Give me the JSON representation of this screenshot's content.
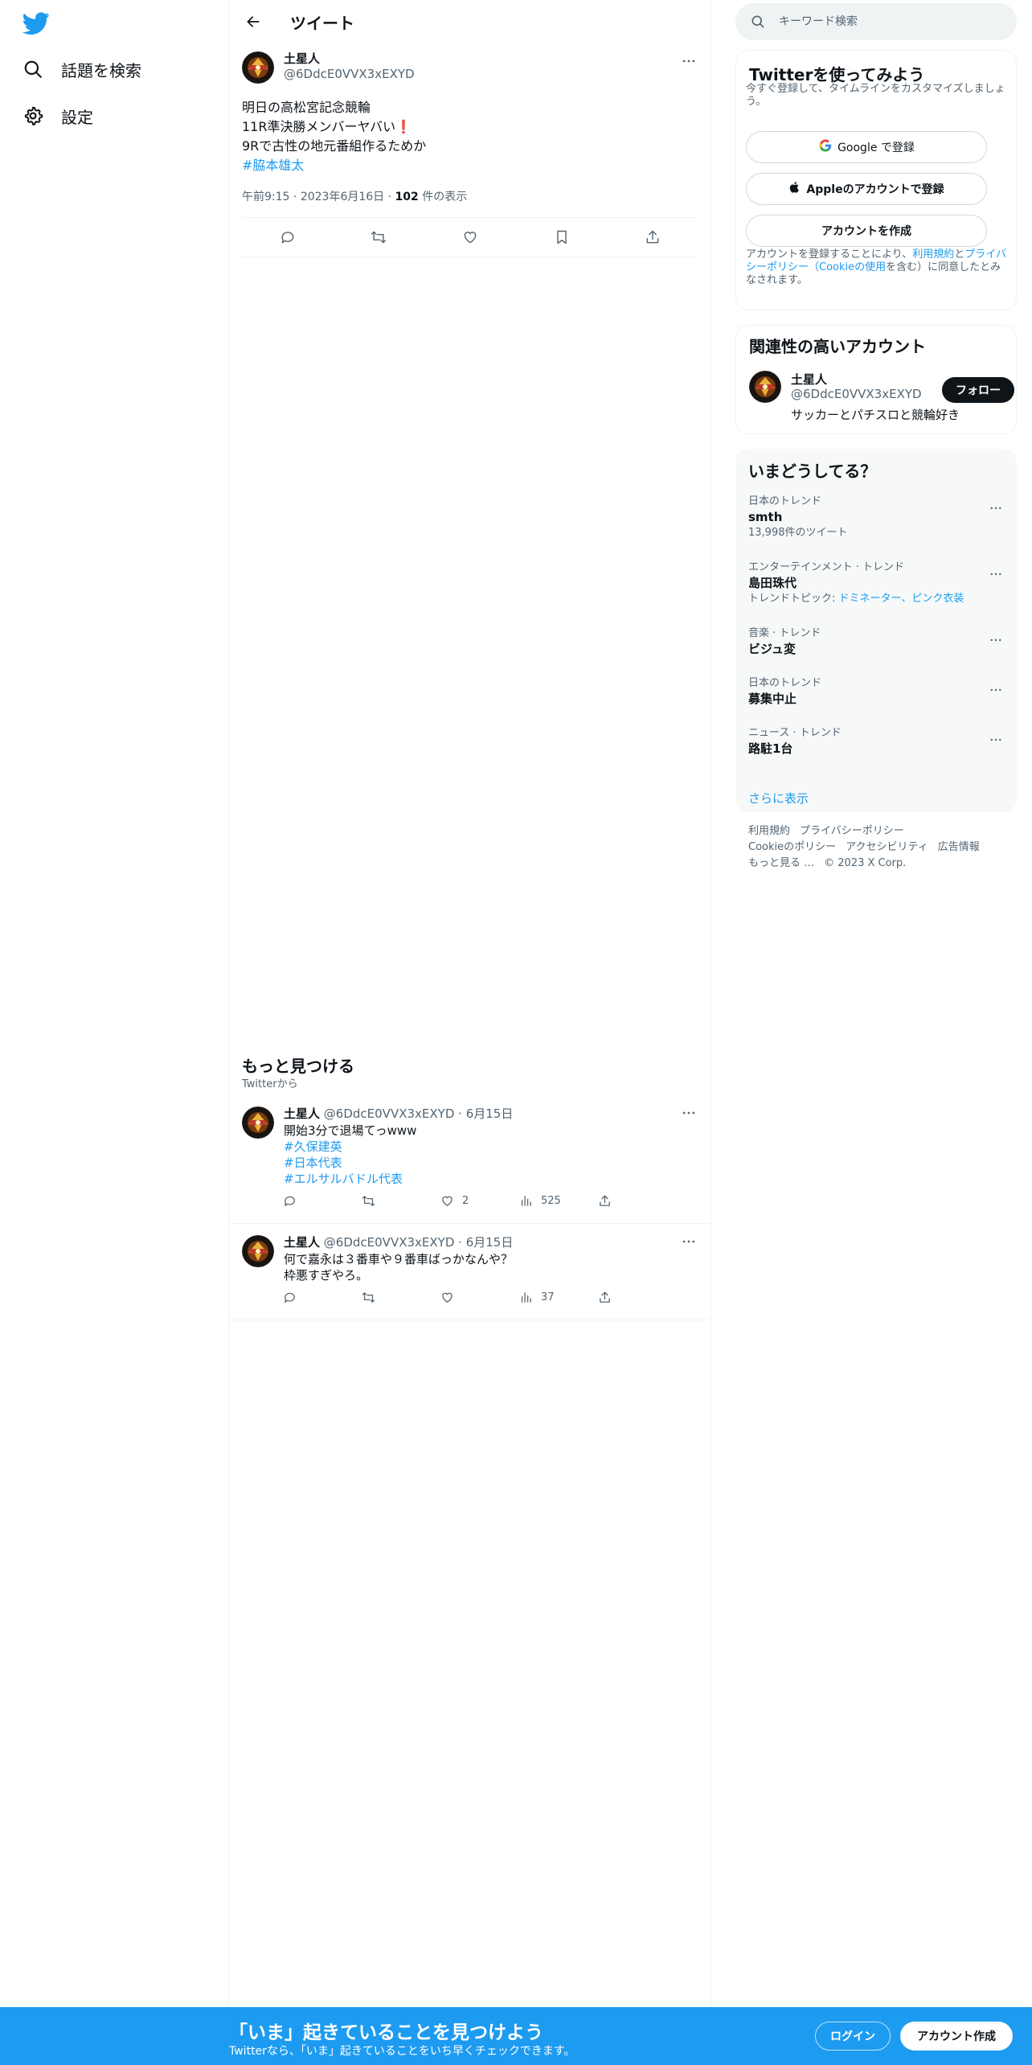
{
  "colors": {
    "brand": "#1d9bf0",
    "text": "#0f1419",
    "muted": "#536471"
  },
  "nav": {
    "logo_icon": "twitter-bird-icon",
    "items": [
      {
        "label": "話題を検索",
        "icon": "search-icon"
      },
      {
        "label": "設定",
        "icon": "gear-icon"
      }
    ]
  },
  "main": {
    "header_title": "ツイート",
    "tweet": {
      "name": "土星人",
      "handle": "@6DdcE0VVX3xEXYD",
      "lines": [
        "明日の高松宮記念競輪",
        "11R準決勝メンバーヤバい❗️",
        "9Rで古性の地元番組作るためか"
      ],
      "hashtag": "#脇本雄太",
      "time": "午前9:15",
      "date": "2023年6月16日",
      "views_count": "102",
      "views_label": "件の表示"
    },
    "more": {
      "title": "もっと見つける",
      "subtitle": "Twitterから",
      "cards": [
        {
          "name": "土星人",
          "handle": "@6DdcE0VVX3xEXYD",
          "date": "6月15日",
          "text": "開始3分で退場てっwww",
          "hashtags": [
            "#久保建英",
            "#日本代表",
            "#エルサルバドル代表"
          ],
          "likes": "2",
          "views": "525"
        },
        {
          "name": "土星人",
          "handle": "@6DdcE0VVX3xEXYD",
          "date": "6月15日",
          "lines": [
            "何で嘉永は３番車や９番車ばっかなんや？",
            "枠悪すぎやろ。"
          ],
          "likes": "",
          "views": "37"
        }
      ]
    }
  },
  "right": {
    "search_placeholder": "キーワード検索",
    "signup": {
      "title": "Twitterを使ってみよう",
      "subtitle": "今すぐ登録して、タイムラインをカスタマイズしましょう。",
      "google_label": "Google で登録",
      "apple_label": "Appleのアカウントで登録",
      "create_label": "アカウントを作成",
      "legal_pre": "アカウントを登録することにより、",
      "legal_terms": "利用規約",
      "legal_and": "と",
      "legal_privacy": "プライバシーポリシー（Cookieの使用",
      "legal_post": "を含む）に同意したとみなされます。"
    },
    "related": {
      "title": "関連性の高いアカウント",
      "name": "土星人",
      "handle": "@6DdcE0VVX3xEXYD",
      "bio": "サッカーとパチスロと競輪好き",
      "follow_label": "フォロー"
    },
    "trends": {
      "title": "いまどうしてる？",
      "items": [
        {
          "context": "日本のトレンド",
          "name": "smth",
          "extra": "13,998件のツイート"
        },
        {
          "context": "エンターテインメント · トレンド",
          "name": "島田珠代",
          "extra_pre": "トレンドトピック: ",
          "extra_links": "ドミネーター、ピンク衣装"
        },
        {
          "context": "音楽 · トレンド",
          "name": "ビジュ変"
        },
        {
          "context": "日本のトレンド",
          "name": "募集中止"
        },
        {
          "context": "ニュース · トレンド",
          "name": "路駐1台"
        }
      ],
      "show_more": "さらに表示"
    },
    "footer": [
      "利用規約",
      "プライバシーポリシー",
      "Cookieのポリシー",
      "アクセシビリティ",
      "広告情報",
      "もっと見る …",
      "© 2023 X Corp."
    ]
  },
  "bottom": {
    "title": "「いま」起きていることを見つけよう",
    "subtitle": "Twitterなら、「いま」起きていることをいち早くチェックできます。",
    "login_label": "ログイン",
    "signup_label": "アカウント作成"
  }
}
